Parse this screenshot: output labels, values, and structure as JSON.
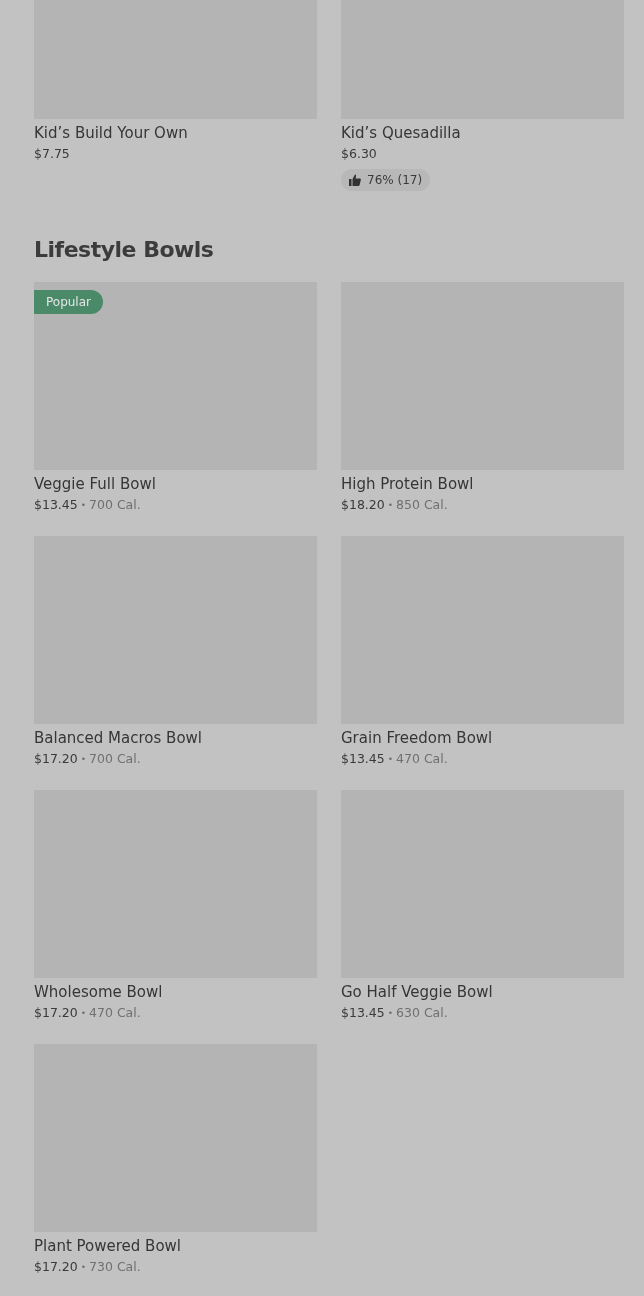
{
  "previous_items": [
    {
      "name": "Kid’s Build Your Own",
      "price": "$7.75"
    },
    {
      "name": "Kid’s Quesadilla",
      "price": "$6.30",
      "rating": "76% (17)"
    }
  ],
  "section": {
    "title": "Lifestyle Bowls",
    "items": [
      {
        "name": "Veggie Full Bowl",
        "price": "$13.45",
        "separator": "•",
        "calories": "700 Cal.",
        "badge": "Popular"
      },
      {
        "name": "High Protein Bowl",
        "price": "$18.20",
        "separator": "•",
        "calories": "850 Cal."
      },
      {
        "name": "Balanced Macros Bowl",
        "price": "$17.20",
        "separator": "•",
        "calories": "700 Cal."
      },
      {
        "name": "Grain Freedom Bowl",
        "price": "$13.45",
        "separator": "•",
        "calories": "470 Cal."
      },
      {
        "name": "Wholesome Bowl",
        "price": "$17.20",
        "separator": "•",
        "calories": "470 Cal."
      },
      {
        "name": "Go Half Veggie Bowl",
        "price": "$13.45",
        "separator": "•",
        "calories": "630 Cal."
      },
      {
        "name": "Plant Powered Bowl",
        "price": "$17.20",
        "separator": "•",
        "calories": "730 Cal."
      }
    ]
  }
}
